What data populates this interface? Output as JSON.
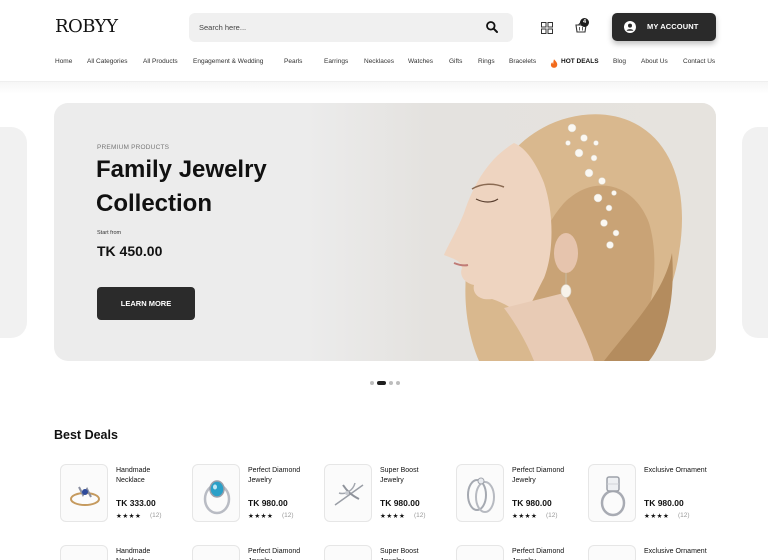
{
  "brand": {
    "logo": "ROBYY"
  },
  "search": {
    "placeholder": "Search here..."
  },
  "cart": {
    "count": "4"
  },
  "account": {
    "label": "MY ACCOUNT"
  },
  "nav": [
    "Home",
    "All Categories",
    "All Products",
    "Engagement & Wedding",
    "Pearls",
    "Earrings",
    "Necklaces",
    "Watches",
    "Gifts",
    "Rings",
    "Bracelets",
    "HOT DEALS",
    "Blog",
    "About Us",
    "Contact Us"
  ],
  "hero": {
    "kicker": "PREMIUM PRODUCTS",
    "title": "Family Jewelry Collection",
    "start_label": "Start from",
    "price": "TK 450.00",
    "cta": "LEARN MORE",
    "slides": 4,
    "active_slide": 2
  },
  "deals": {
    "title": "Best Deals",
    "products": [
      {
        "name": "Handmade Necklace",
        "price": "TK 333.00",
        "stars": "★★★★",
        "count": "(12)"
      },
      {
        "name": "Perfect Diamond Jewelry",
        "price": "TK 980.00",
        "stars": "★★★★",
        "count": "(12)"
      },
      {
        "name": "Super Boost Jewelry",
        "price": "TK 980.00",
        "stars": "★★★★",
        "count": "(12)"
      },
      {
        "name": "Perfect Diamond Jewelry",
        "price": "TK 980.00",
        "stars": "★★★★",
        "count": "(12)"
      },
      {
        "name": "Exclusive Ornament",
        "price": "TK 980.00",
        "stars": "★★★★",
        "count": "(12)"
      }
    ],
    "products_row2": [
      {
        "name": "Handmade Necklace"
      },
      {
        "name": "Perfect Diamond Jewelry"
      },
      {
        "name": "Super Boost Jewelry"
      },
      {
        "name": "Perfect Diamond Jewelry"
      },
      {
        "name": "Exclusive Ornament"
      }
    ]
  },
  "colors": {
    "accent": "#2a2a2a",
    "hot": "#f26b1d",
    "hero_bg": "#ececec"
  }
}
